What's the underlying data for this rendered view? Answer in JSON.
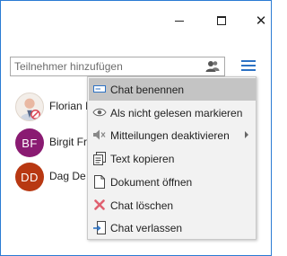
{
  "window": {
    "minimize_glyph": "minimize-icon",
    "maximize_glyph": "maximize-icon",
    "close_glyph": "close-icon"
  },
  "search": {
    "placeholder": "Teilnehmer hinzufügen",
    "value": "",
    "icon": "add-participant-icon"
  },
  "menu_button": {
    "icon": "hamburger-menu-icon",
    "color": "#2d72c4"
  },
  "participants": [
    {
      "name": "Florian I",
      "initials": "",
      "avatar": "photo-avatar-blocked",
      "color": "#f3eee9"
    },
    {
      "name": "Birgit Fr",
      "initials": "BF",
      "avatar": "initials",
      "color": "#8a1b72"
    },
    {
      "name": "Dag De",
      "initials": "DD",
      "avatar": "initials",
      "color": "#b83812"
    }
  ],
  "context_menu": {
    "items": [
      {
        "label": "Chat benennen",
        "icon": "rename-icon",
        "highlighted": true
      },
      {
        "label": "Als nicht gelesen markieren",
        "icon": "eye-icon"
      },
      {
        "label": "Mitteilungen deaktivieren",
        "icon": "mute-speaker-icon",
        "submenu": true
      },
      {
        "label": "Text kopieren",
        "icon": "copy-text-icon"
      },
      {
        "label": "Dokument öffnen",
        "icon": "document-icon"
      },
      {
        "label": "Chat löschen",
        "icon": "delete-x-icon",
        "color": "#e06070"
      },
      {
        "label": "Chat verlassen",
        "icon": "leave-chat-icon"
      }
    ]
  }
}
